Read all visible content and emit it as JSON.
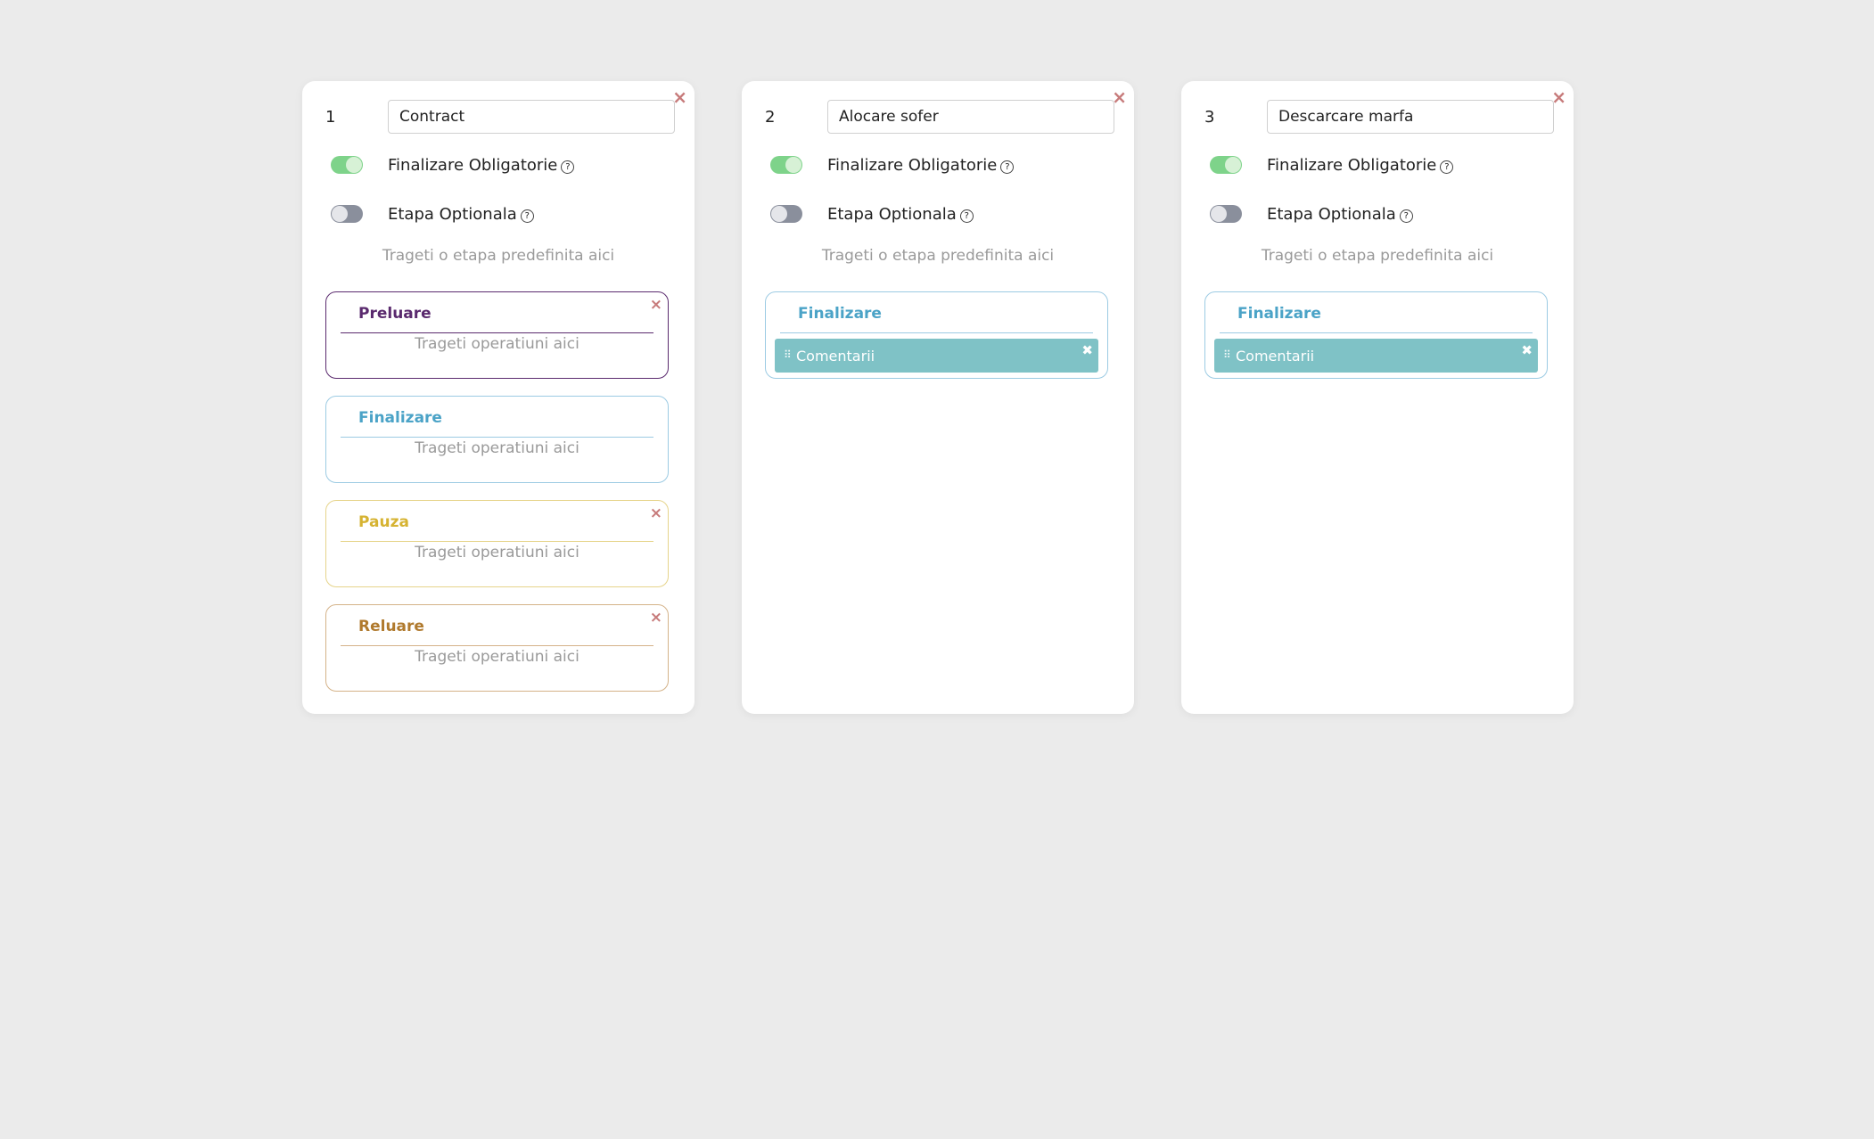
{
  "colors": {
    "background": "#ebebeb",
    "toggle_on": "#7ed38a",
    "toggle_off": "#8a8f9c",
    "close_red": "#c77b7b",
    "preluare": "#5a2a6e",
    "finalizare": "#4ba3c7",
    "pauza": "#d6b332",
    "reluare": "#b07a2e",
    "operation_bg": "#7fc2c6"
  },
  "labels": {
    "finalizare_obligatorie": "Finalizare Obligatorie",
    "etapa_optionala": "Etapa Optionala",
    "help": "?",
    "drop_stage_hint": "Trageti o etapa predefinita aici",
    "drop_ops_hint": "Trageti operatiuni aici",
    "close": "×",
    "op_close": "✖",
    "grip": "⠿"
  },
  "cards": [
    {
      "number": "1",
      "name": "Contract",
      "finalizare_obligatorie": true,
      "etapa_optionala": false,
      "stages": [
        {
          "title": "Preluare",
          "color": "#5a2a6e",
          "closable": true,
          "operations": []
        },
        {
          "title": "Finalizare",
          "color": "#4ba3c7",
          "closable": false,
          "operations": []
        },
        {
          "title": "Pauza",
          "color": "#d6b332",
          "closable": true,
          "operations": []
        },
        {
          "title": "Reluare",
          "color": "#b07a2e",
          "closable": true,
          "operations": []
        }
      ]
    },
    {
      "number": "2",
      "name": "Alocare sofer",
      "finalizare_obligatorie": true,
      "etapa_optionala": false,
      "stages": [
        {
          "title": "Finalizare",
          "color": "#4ba3c7",
          "closable": false,
          "operations": [
            "Comentarii"
          ]
        }
      ]
    },
    {
      "number": "3",
      "name": "Descarcare marfa",
      "finalizare_obligatorie": true,
      "etapa_optionala": false,
      "stages": [
        {
          "title": "Finalizare",
          "color": "#4ba3c7",
          "closable": false,
          "operations": [
            "Comentarii"
          ]
        }
      ]
    }
  ]
}
